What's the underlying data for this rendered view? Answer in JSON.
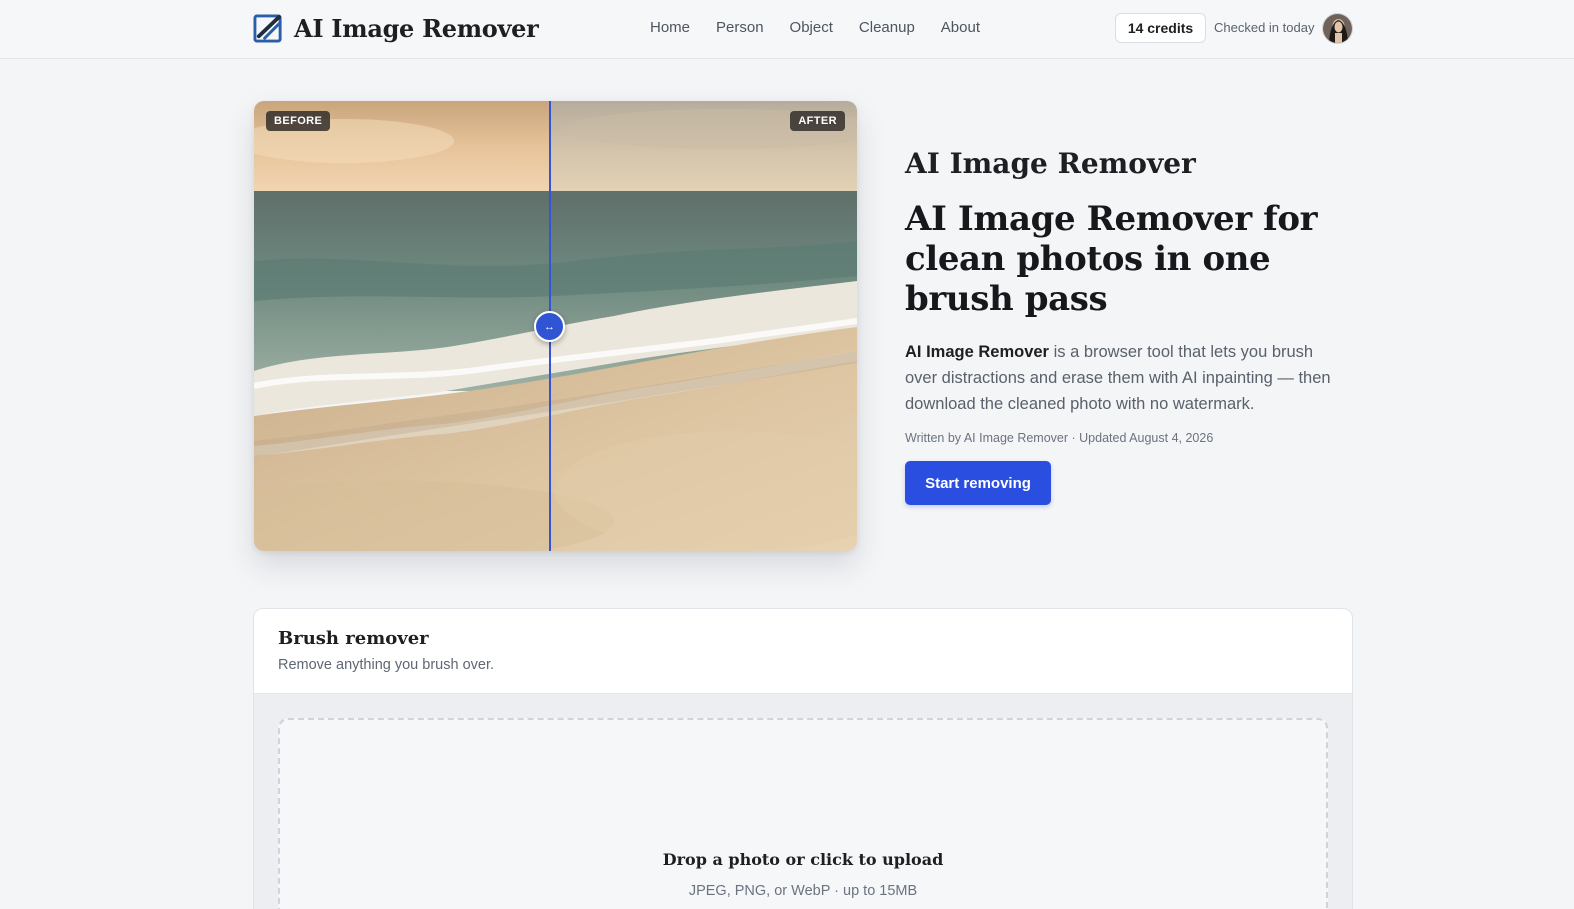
{
  "header": {
    "brand": "AI Image Remover",
    "nav": [
      "Home",
      "Person",
      "Object",
      "Cleanup",
      "About"
    ],
    "credits": "14 credits",
    "checkin": "Checked in today"
  },
  "hero": {
    "before_label": "BEFORE",
    "after_label": "AFTER",
    "handle_glyph": "↔",
    "eyebrow": "AI Image Remover",
    "headline": "AI Image Remover for clean photos in one brush pass",
    "desc_strong": "AI Image Remover",
    "desc_rest": " is a browser tool that lets you brush over distractions and erase them with AI inpainting — then download the cleaned photo with no watermark.",
    "byline": "Written by AI Image Remover · Updated August 4, 2026",
    "cta": "Start removing"
  },
  "tool": {
    "title": "Brush remover",
    "subtitle": "Remove anything you brush over.",
    "drop_title": "Drop a photo or click to upload",
    "drop_sub": "JPEG, PNG, or WebP · up to 15MB"
  },
  "colors": {
    "accent": "#2a4fe0",
    "background": "#f4f5f7"
  }
}
